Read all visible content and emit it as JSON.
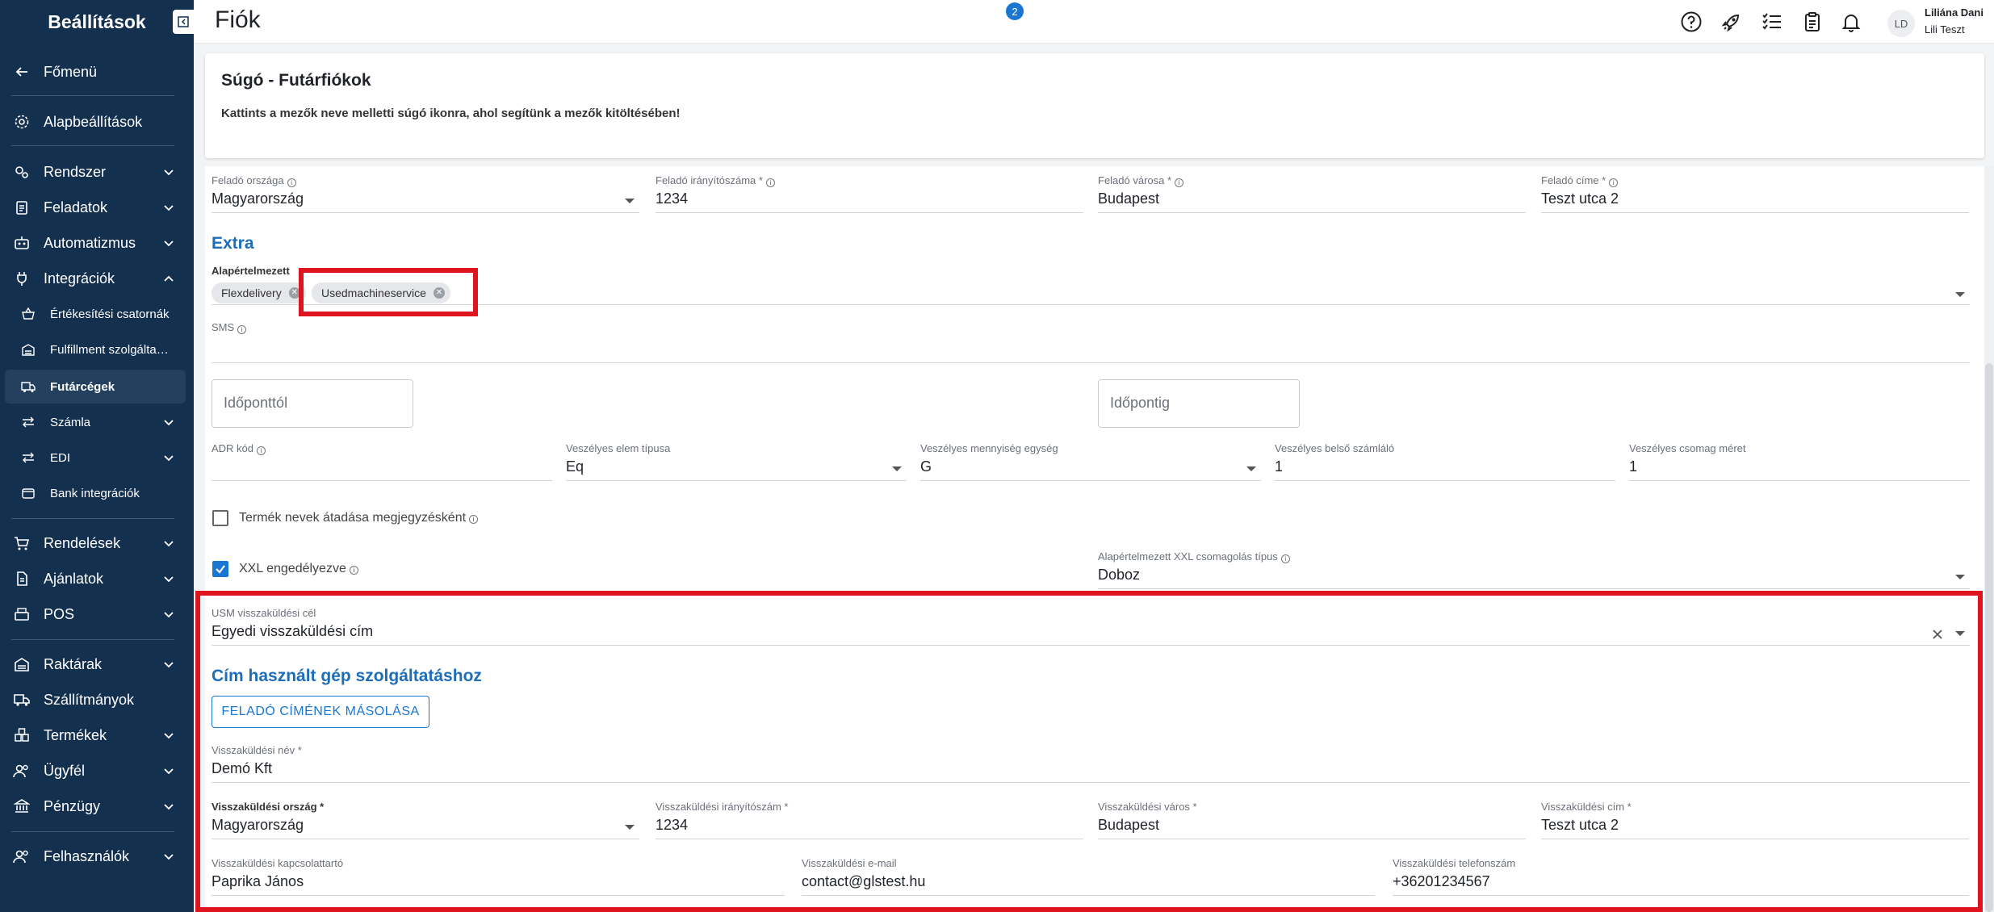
{
  "sidebar": {
    "title": "Beállítások",
    "items": [
      {
        "label": "Főmenü",
        "icon": "arrow-left-icon"
      },
      {
        "label": "Alapbeállítások",
        "icon": "gear-icon"
      },
      {
        "label": "Rendszer",
        "icon": "cogs-icon"
      },
      {
        "label": "Feladatok",
        "icon": "clipboard-icon"
      },
      {
        "label": "Automatizmus",
        "icon": "robot-icon"
      },
      {
        "label": "Integrációk",
        "icon": "plug-icon"
      },
      {
        "label": "Értékesítési csatornák",
        "icon": "basket-icon"
      },
      {
        "label": "Fulfillment szolgáltatók",
        "icon": "warehouse-icon"
      },
      {
        "label": "Futárcégek",
        "icon": "truck-icon"
      },
      {
        "label": "Számla",
        "icon": "swap-icon"
      },
      {
        "label": "EDI",
        "icon": "swap-icon"
      },
      {
        "label": "Bank integrációk",
        "icon": "wallet-icon"
      },
      {
        "label": "Rendelések",
        "icon": "cart-icon"
      },
      {
        "label": "Ajánlatok",
        "icon": "document-icon"
      },
      {
        "label": "POS",
        "icon": "register-icon"
      },
      {
        "label": "Raktárak",
        "icon": "warehouse-icon"
      },
      {
        "label": "Szállítmányok",
        "icon": "truck-icon"
      },
      {
        "label": "Termékek",
        "icon": "boxes-icon"
      },
      {
        "label": "Ügyfél",
        "icon": "users-icon"
      },
      {
        "label": "Pénzügy",
        "icon": "bank-icon"
      },
      {
        "label": "Felhasználók",
        "icon": "users-icon"
      }
    ]
  },
  "header": {
    "title": "Fiók",
    "badge_count": "2",
    "user_initials": "LD",
    "user_name": "Liliána Dani",
    "user_sub": "Lili Teszt"
  },
  "help": {
    "title": "Súgó - Futárfiókok",
    "text": "Kattints a mezők neve melletti súgó ikonra, ahol segítünk a mezők kitöltésében!"
  },
  "form": {
    "sender_country_label": "Feladó országa",
    "sender_country": "Magyarország",
    "sender_zip_label": "Feladó irányítószáma *",
    "sender_zip": "1234",
    "sender_city_label": "Feladó városa *",
    "sender_city": "Budapest",
    "sender_address_label": "Feladó címe *",
    "sender_address": "Teszt utca 2",
    "extra_title": "Extra",
    "default_services_label": "Alapértelmezett",
    "chips": [
      "Flexdelivery",
      "Usedmachineservice"
    ],
    "sms_label": "SMS",
    "time_from_placeholder": "Időponttól",
    "time_to_placeholder": "Időpontig",
    "adr_label": "ADR kód",
    "dangerous_type_label": "Veszélyes elem típusa",
    "dangerous_type": "Eq",
    "dangerous_unit_label": "Veszélyes mennyiség egység",
    "dangerous_unit": "G",
    "dangerous_counter_label": "Veszélyes belső számláló",
    "dangerous_counter": "1",
    "dangerous_size_label": "Veszélyes csomag méret",
    "dangerous_size": "1",
    "product_names_label": "Termék nevek átadása megjegyzésként",
    "xxl_label": "XXL engedélyezve",
    "xxl_pack_label": "Alapértelmezett XXL csomagolás típus",
    "xxl_pack": "Doboz",
    "usm_target_label": "USM visszaküldési cél",
    "usm_target": "Egyedi visszaküldési cím",
    "used_machine_title": "Cím használt gép szolgáltatáshoz",
    "copy_button": "FELADÓ CÍMÉNEK MÁSOLÁSA",
    "return_name_label": "Visszaküldési név *",
    "return_name": "Demó Kft",
    "return_country_label": "Visszaküldési ország *",
    "return_country": "Magyarország",
    "return_zip_label": "Visszaküldési irányítószám *",
    "return_zip": "1234",
    "return_city_label": "Visszaküldési város *",
    "return_city": "Budapest",
    "return_address_label": "Visszaküldési cím *",
    "return_address": "Teszt utca 2",
    "return_contact_label": "Visszaküldési kapcsolattartó",
    "return_contact": "Paprika János",
    "return_email_label": "Visszaküldési e-mail",
    "return_email": "contact@glstest.hu",
    "return_phone_label": "Visszaküldési telefonszám",
    "return_phone": "+36201234567"
  },
  "colors": {
    "sidebar_bg": "#14304f",
    "accent": "#1976d2",
    "section_title": "#1e6db8",
    "highlight_red": "#e0141e"
  }
}
